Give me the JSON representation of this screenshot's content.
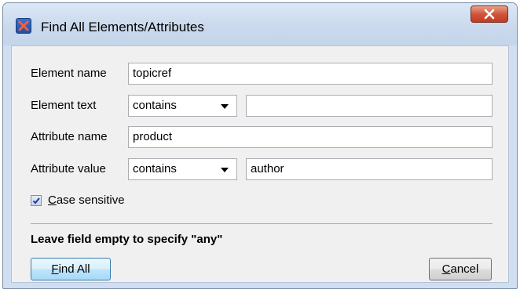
{
  "window": {
    "title": "Find All Elements/Attributes"
  },
  "form": {
    "element_name": {
      "label": "Element name",
      "value": "topicref"
    },
    "element_text": {
      "label": "Element text",
      "mode": "contains",
      "value": ""
    },
    "attribute_name": {
      "label": "Attribute name",
      "value": "product"
    },
    "attribute_value": {
      "label": "Attribute value",
      "mode": "contains",
      "value": "author"
    },
    "case_sensitive": {
      "label_mnemonic": "C",
      "label_rest": "ase sensitive",
      "checked": true
    }
  },
  "hint": "Leave field empty to specify \"any\"",
  "buttons": {
    "find_all": {
      "mnemonic": "F",
      "rest": "ind All"
    },
    "cancel": {
      "mnemonic": "C",
      "rest": "ancel"
    }
  },
  "colors": {
    "accent": "#3c7fb1",
    "close": "#c23b24",
    "frame": "#cfdef0"
  },
  "icons": {
    "app": "oxygen-x-icon",
    "close": "close-icon",
    "dropdown": "chevron-down-icon",
    "check": "checkmark-icon"
  }
}
